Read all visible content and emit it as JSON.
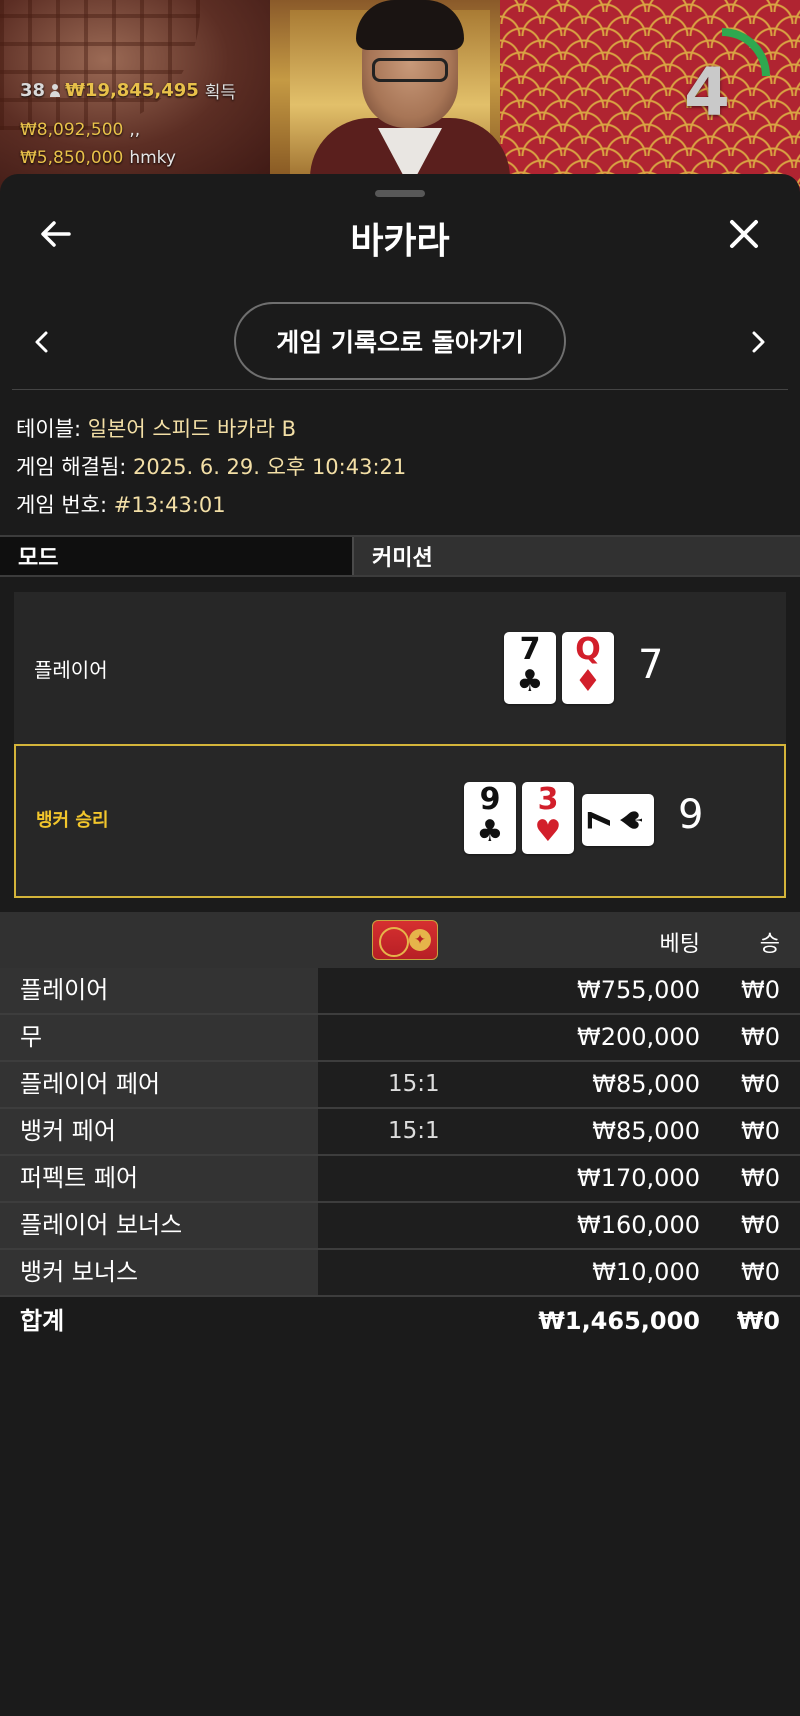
{
  "video": {
    "players_count": "38",
    "total_won": "₩19,845,495",
    "gain_label": "획득",
    "winners": [
      {
        "amount": "₩8,092,500",
        "name": ",,"
      },
      {
        "amount": "₩5,850,000",
        "name": "hmky"
      }
    ],
    "timer": "4",
    "timer_fraction": 0.25
  },
  "header": {
    "title": "바카라",
    "back_icon": "arrow-left-icon",
    "close_icon": "close-icon"
  },
  "history": {
    "back_to_history": "게임 기록으로 돌아가기"
  },
  "info": {
    "table_label": "테이블:",
    "table_value": "일본어 스피드 바카라 B",
    "resolved_label": "게임 해결됨:",
    "resolved_value": "2025. 6. 29. 오후 10:43:21",
    "number_label": "게임 번호:",
    "number_value": "#13:43:01"
  },
  "mode": {
    "label": "모드",
    "value": "커미션"
  },
  "hands": {
    "player": {
      "label": "플레이어",
      "score": "7",
      "cards": [
        {
          "rank": "7",
          "suit": "♣",
          "color": "black"
        },
        {
          "rank": "Q",
          "suit": "♦",
          "color": "red"
        }
      ]
    },
    "banker": {
      "label": "뱅커 승리",
      "score": "9",
      "cards": [
        {
          "rank": "9",
          "suit": "♣",
          "color": "black"
        },
        {
          "rank": "3",
          "suit": "♥",
          "color": "red"
        },
        {
          "rank": "7",
          "suit": "♠",
          "color": "black",
          "orientation": "sideways"
        }
      ]
    }
  },
  "bets": {
    "header": {
      "bet": "베팅",
      "win": "승"
    },
    "rows": [
      {
        "name": "플레이어",
        "odds": "",
        "amount": "₩755,000",
        "win": "₩0"
      },
      {
        "name": "무",
        "odds": "",
        "amount": "₩200,000",
        "win": "₩0"
      },
      {
        "name": "플레이어 페어",
        "odds": "15:1",
        "amount": "₩85,000",
        "win": "₩0"
      },
      {
        "name": "뱅커 페어",
        "odds": "15:1",
        "amount": "₩85,000",
        "win": "₩0"
      },
      {
        "name": "퍼펙트 페어",
        "odds": "",
        "amount": "₩170,000",
        "win": "₩0"
      },
      {
        "name": "플레이어 보너스",
        "odds": "",
        "amount": "₩160,000",
        "win": "₩0"
      },
      {
        "name": "뱅커 보너스",
        "odds": "",
        "amount": "₩10,000",
        "win": "₩0"
      }
    ],
    "total": {
      "name": "합계",
      "amount": "₩1,465,000",
      "win": "₩0"
    }
  },
  "colors": {
    "gold": "#e8c14a",
    "banker_highlight": "#d4b43a",
    "timer_green": "#2fa84f"
  }
}
